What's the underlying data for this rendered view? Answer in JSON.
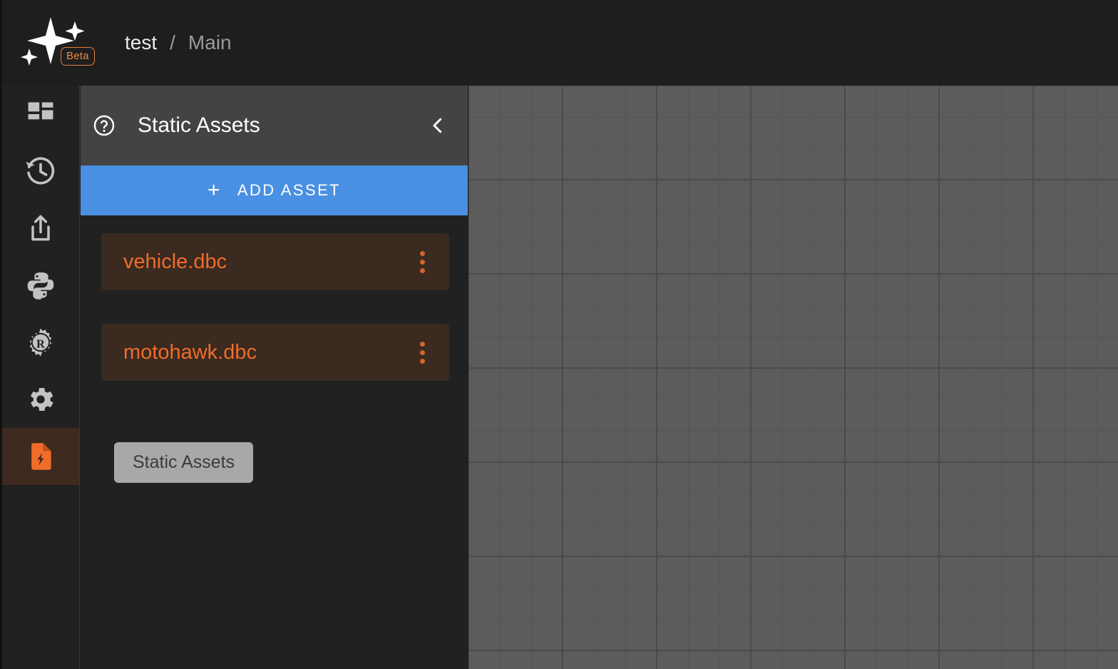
{
  "topbar": {
    "logo_name": "sparkle-logo",
    "beta_label": "Beta",
    "breadcrumb": {
      "project": "test",
      "separator": "/",
      "branch": "Main"
    }
  },
  "rail": {
    "items": [
      {
        "name": "dashboard",
        "icon": "grid-dashboard-icon",
        "active": false
      },
      {
        "name": "history",
        "icon": "history-clock-icon",
        "active": false
      },
      {
        "name": "export",
        "icon": "share-export-icon",
        "active": false
      },
      {
        "name": "python",
        "icon": "python-logo-icon",
        "active": false
      },
      {
        "name": "rust",
        "icon": "rust-logo-icon",
        "active": false
      },
      {
        "name": "settings",
        "icon": "gear-icon",
        "active": false
      },
      {
        "name": "static-assets",
        "icon": "asset-file-icon",
        "active": true
      }
    ]
  },
  "panel": {
    "help_icon": "help-circle-icon",
    "title": "Static Assets",
    "collapse_icon": "chevron-left-icon",
    "add_button": {
      "plus": "+",
      "label": "ADD ASSET"
    },
    "assets": [
      {
        "name": "vehicle.dbc",
        "menu_icon": "more-vertical-icon"
      },
      {
        "name": "motohawk.dbc",
        "menu_icon": "more-vertical-icon"
      }
    ],
    "tooltip_label": "Static Assets"
  },
  "colors": {
    "accent_blue": "#4a90e2",
    "accent_orange": "#ef6c2a",
    "asset_card_bg": "#3a2a20",
    "panel_bg": "#212121",
    "header_bg": "#434343",
    "canvas_bg": "#5c5c5c",
    "grid_line": "#555555",
    "grid_major_line": "#4a4a4a",
    "tooltip_bg": "#a8a8a8"
  }
}
